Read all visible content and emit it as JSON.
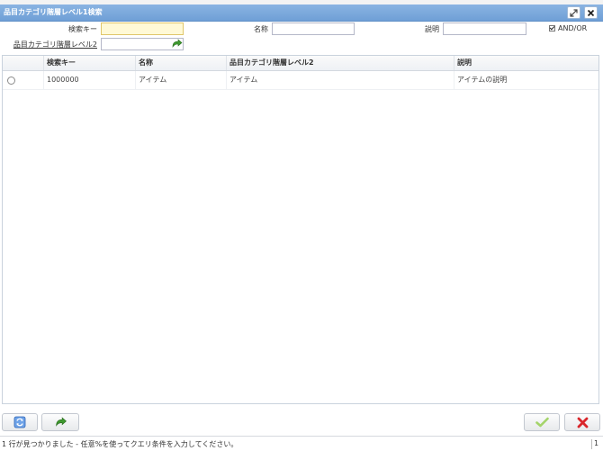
{
  "window": {
    "title": "品目カテゴリ階層レベル1検索"
  },
  "search": {
    "search_key_label": "検索キー",
    "search_key_value": "",
    "name_label": "名称",
    "name_value": "",
    "description_label": "説明",
    "description_value": "",
    "and_or_label": "AND/OR",
    "and_or_checked": true,
    "level2_label": "品目カテゴリ階層レベル2",
    "level2_value": ""
  },
  "grid": {
    "columns": [
      "",
      "検索キー",
      "名称",
      "品目カテゴリ階層レベル2",
      "説明"
    ],
    "rows": [
      {
        "search_key": "1000000",
        "name": "アイテム",
        "level2": "アイテム",
        "description": "アイテムの説明"
      }
    ]
  },
  "status": {
    "message": "1 行が見つかりました - 任意%を使ってクエリ条件を入力してください。",
    "count": "1"
  },
  "colors": {
    "title_bar": "#7aa7da",
    "focused_field": "#fff9d6",
    "ok_check": "#7cc242",
    "cancel_x": "#d9262b",
    "refresh_icon": "#3a7bd5",
    "zoom_arrow": "#3f9a2f"
  },
  "icons": [
    "maximize-icon",
    "close-icon",
    "zoom-arrow-icon",
    "refresh-icon",
    "ok-check-icon",
    "cancel-x-icon"
  ]
}
